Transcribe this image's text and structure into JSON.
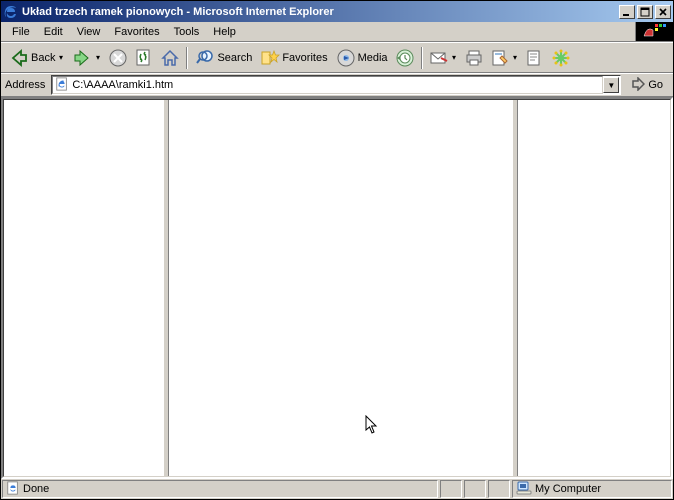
{
  "title": "Układ trzech ramek pionowych - Microsoft Internet Explorer",
  "menu": {
    "file": "File",
    "edit": "Edit",
    "view": "View",
    "favorites": "Favorites",
    "tools": "Tools",
    "help": "Help"
  },
  "toolbar": {
    "back": "Back",
    "search": "Search",
    "favorites": "Favorites",
    "media": "Media"
  },
  "addressbar": {
    "label": "Address",
    "value": "C:\\AAAA\\ramki1.htm",
    "go": "Go"
  },
  "statusbar": {
    "done": "Done",
    "zone": "My Computer"
  }
}
